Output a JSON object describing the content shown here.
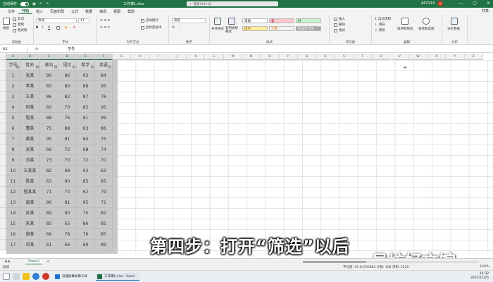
{
  "titlebar": {
    "autosave_label": "自动保存",
    "autosave_state": "关",
    "document_title": "工作簿1.xlsx",
    "search_placeholder": "搜索(Alt+Q)",
    "user_name": "AP2314",
    "avatar_initial": "A",
    "window_controls": [
      "—",
      "▢",
      "✕"
    ]
  },
  "menubar": {
    "tabs": [
      "文件",
      "开始",
      "插入",
      "页面布局",
      "公式",
      "数据",
      "审阅",
      "视图",
      "帮助"
    ],
    "active_tab": "开始",
    "share_label": "共享"
  },
  "ribbon": {
    "groups": [
      {
        "name": "剪贴板",
        "items": [
          "粘贴",
          "剪切",
          "复制",
          "格式刷"
        ]
      },
      {
        "name": "字体",
        "font_name": "等线",
        "font_size": "11",
        "items": [
          "B",
          "I",
          "U"
        ]
      },
      {
        "name": "对齐方式",
        "items": [
          "自动换行",
          "合并后居中"
        ]
      },
      {
        "name": "数字",
        "format": "常规",
        "items": [
          "%",
          ","
        ]
      },
      {
        "name": "样式",
        "items": [
          "条件格式",
          "套用表格格式"
        ],
        "styles": [
          {
            "label": "常规",
            "bg": "#ffffff",
            "fg": "#222222"
          },
          {
            "label": "差",
            "bg": "#ffc7ce",
            "fg": "#9c0006"
          },
          {
            "label": "好",
            "bg": "#c6efce",
            "fg": "#006100"
          },
          {
            "label": "适中",
            "bg": "#ffeb9c",
            "fg": "#9c5700"
          },
          {
            "label": "计算",
            "bg": "#f2f2f2",
            "fg": "#fa7d00"
          },
          {
            "label": "检查单元格",
            "bg": "#a5a5a5",
            "fg": "#ffffff"
          }
        ]
      },
      {
        "name": "单元格",
        "items": [
          "插入",
          "删除",
          "格式"
        ]
      },
      {
        "name": "编辑",
        "items": [
          "自动求和",
          "填充",
          "清除",
          "排序和筛选",
          "查找和选择"
        ]
      },
      {
        "name": "分析",
        "items": [
          "分析数据"
        ]
      }
    ]
  },
  "formulabar": {
    "name_box": "A1",
    "fx": "fx",
    "content": "学号"
  },
  "grid": {
    "columns": [
      "A",
      "B",
      "C",
      "D",
      "E",
      "F",
      "G",
      "H",
      "I",
      "J",
      "K",
      "L",
      "M",
      "N",
      "O",
      "P",
      "Q",
      "R",
      "S",
      "T",
      "U",
      "V",
      "W",
      "X",
      "Y",
      "Z"
    ],
    "selected_columns": [
      "A",
      "B",
      "C",
      "D",
      "E",
      "F"
    ],
    "rows": [
      1,
      2,
      3,
      4,
      5,
      6,
      7,
      8,
      9,
      10,
      11,
      12,
      13,
      14,
      15,
      16,
      17,
      18
    ]
  },
  "table": {
    "headers": [
      "学号",
      "姓名",
      "政治",
      "语文",
      "数学",
      "英语"
    ],
    "rows": [
      [
        "1",
        "张某",
        "90",
        "86",
        "93",
        "84"
      ],
      [
        "2",
        "李某",
        "83",
        "80",
        "88",
        "95"
      ],
      [
        "3",
        "王某",
        "86",
        "82",
        "87",
        "76"
      ],
      [
        "4",
        "何某",
        "60",
        "70",
        "85",
        "95"
      ],
      [
        "5",
        "程某",
        "88",
        "76",
        "81",
        "99"
      ],
      [
        "6",
        "曹某",
        "75",
        "88",
        "63",
        "86"
      ],
      [
        "7",
        "黄某",
        "95",
        "81",
        "84",
        "75"
      ],
      [
        "8",
        "吴某",
        "66",
        "72",
        "68",
        "74"
      ],
      [
        "9",
        "刘某",
        "73",
        "70",
        "72",
        "70"
      ],
      [
        "10",
        "王某某",
        "82",
        "68",
        "93",
        "63"
      ],
      [
        "11",
        "陈某",
        "63",
        "90",
        "85",
        "85"
      ],
      [
        "12",
        "程某某",
        "71",
        "73",
        "62",
        "79"
      ],
      [
        "13",
        "高某",
        "90",
        "81",
        "95",
        "71"
      ],
      [
        "14",
        "孙某",
        "89",
        "90",
        "75",
        "82"
      ],
      [
        "15",
        "朱某",
        "85",
        "65",
        "86",
        "85"
      ],
      [
        "16",
        "谢某",
        "68",
        "78",
        "76",
        "85"
      ],
      [
        "17",
        "邓某",
        "61",
        "66",
        "69",
        "89"
      ]
    ]
  },
  "caption": "第四步：打开“筛选”以后",
  "watermark": "易坊好文馆",
  "sheetbar": {
    "nav": "◀ ▶",
    "sheet_tab": "Sheet1",
    "add": "+"
  },
  "statusbar": {
    "ready": "就绪",
    "stats": "平均值: 65.04705882   计数: 108   求和: 5529",
    "zoom": "100%"
  },
  "taskbar": {
    "apps": [
      {
        "label": "迅捷屏幕录像工具",
        "color": "#1e73d8"
      },
      {
        "label": "工作簿1.xlsx - Excel",
        "color": "#217346"
      }
    ],
    "time": "14:32",
    "date": "2021/11/25"
  }
}
